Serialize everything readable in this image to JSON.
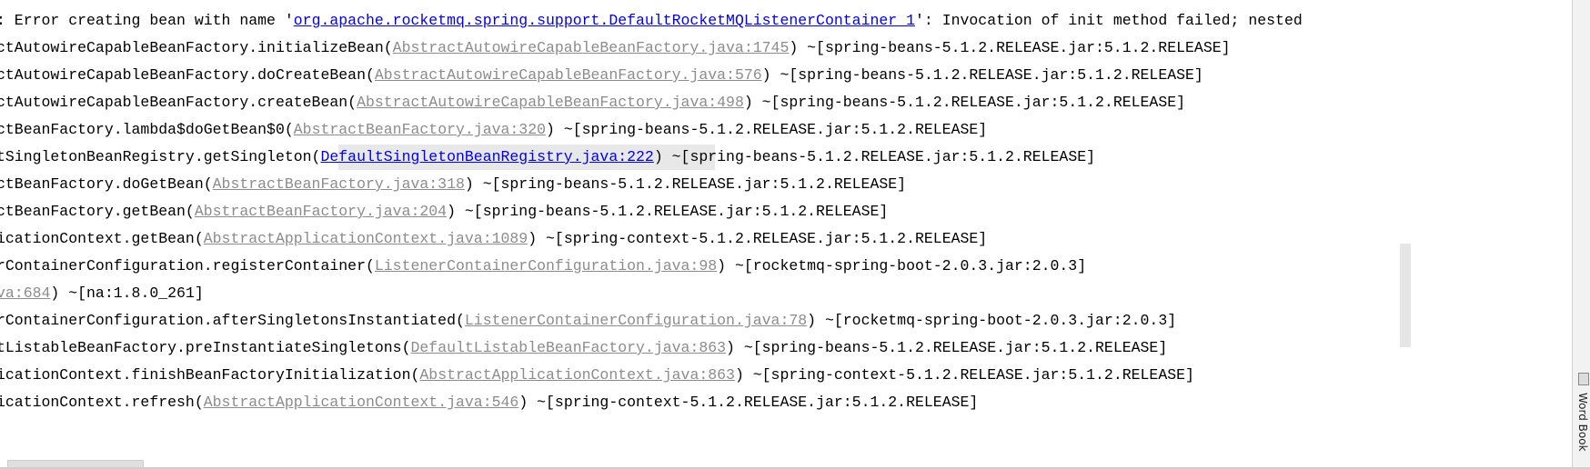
{
  "colors": {
    "link_active": "#0000ee",
    "link_inactive": "#8c8c8c",
    "text": "#000000"
  },
  "lines": [
    {
      "pre": ": Error creating bean with name '",
      "link": "org.apache.rocketmq.spring.support.DefaultRocketMQListenerContainer_1",
      "post": "': Invocation of init method failed; nested"
    },
    {
      "pre": "ctAutowireCapableBeanFactory.initializeBean(",
      "link": "AbstractAutowireCapableBeanFactory.java:1745",
      "post": ") ~[spring-beans-5.1.2.RELEASE.jar:5.1.2.RELEASE]"
    },
    {
      "pre": "ctAutowireCapableBeanFactory.doCreateBean(",
      "link": "AbstractAutowireCapableBeanFactory.java:576",
      "post": ") ~[spring-beans-5.1.2.RELEASE.jar:5.1.2.RELEASE]"
    },
    {
      "pre": "ctAutowireCapableBeanFactory.createBean(",
      "link": "AbstractAutowireCapableBeanFactory.java:498",
      "post": ") ~[spring-beans-5.1.2.RELEASE.jar:5.1.2.RELEASE]"
    },
    {
      "pre": "ctBeanFactory.lambda$doGetBean$0(",
      "link": "AbstractBeanFactory.java:320",
      "post": ") ~[spring-beans-5.1.2.RELEASE.jar:5.1.2.RELEASE]"
    },
    {
      "pre": "tSingletonBeanRegistry.getSingleton(",
      "link": "DefaultSingletonBeanRegistry.java:222",
      "post": ") ~[spring-beans-5.1.2.RELEASE.jar:5.1.2.RELEASE]"
    },
    {
      "pre": "ctBeanFactory.doGetBean(",
      "link": "AbstractBeanFactory.java:318",
      "post": ") ~[spring-beans-5.1.2.RELEASE.jar:5.1.2.RELEASE]"
    },
    {
      "pre": "ctBeanFactory.getBean(",
      "link": "AbstractBeanFactory.java:204",
      "post": ") ~[spring-beans-5.1.2.RELEASE.jar:5.1.2.RELEASE]"
    },
    {
      "pre": "icationContext.getBean(",
      "link": "AbstractApplicationContext.java:1089",
      "post": ") ~[spring-context-5.1.2.RELEASE.jar:5.1.2.RELEASE]"
    },
    {
      "pre": "rContainerConfiguration.registerContainer(",
      "link": "ListenerContainerConfiguration.java:98",
      "post": ") ~[rocketmq-spring-boot-2.0.3.jar:2.0.3]"
    },
    {
      "pre": "",
      "link": "va:684",
      "post": ") ~[na:1.8.0_261]"
    },
    {
      "pre": "rContainerConfiguration.afterSingletonsInstantiated(",
      "link": "ListenerContainerConfiguration.java:78",
      "post": ") ~[rocketmq-spring-boot-2.0.3.jar:2.0.3]"
    },
    {
      "pre": "tListableBeanFactory.preInstantiateSingletons(",
      "link": "DefaultListableBeanFactory.java:863",
      "post": ") ~[spring-beans-5.1.2.RELEASE.jar:5.1.2.RELEASE]"
    },
    {
      "pre": "icationContext.finishBeanFactoryInitialization(",
      "link": "AbstractApplicationContext.java:863",
      "post": ") ~[spring-context-5.1.2.RELEASE.jar:5.1.2.RELEASE]"
    },
    {
      "pre": "icationContext.refresh(",
      "link": "AbstractApplicationContext.java:546",
      "post": ") ~[spring-context-5.1.2.RELEASE.jar:5.1.2.RELEASE]"
    }
  ],
  "side_panel": {
    "label": "Word Book",
    "icon": "book-icon"
  }
}
